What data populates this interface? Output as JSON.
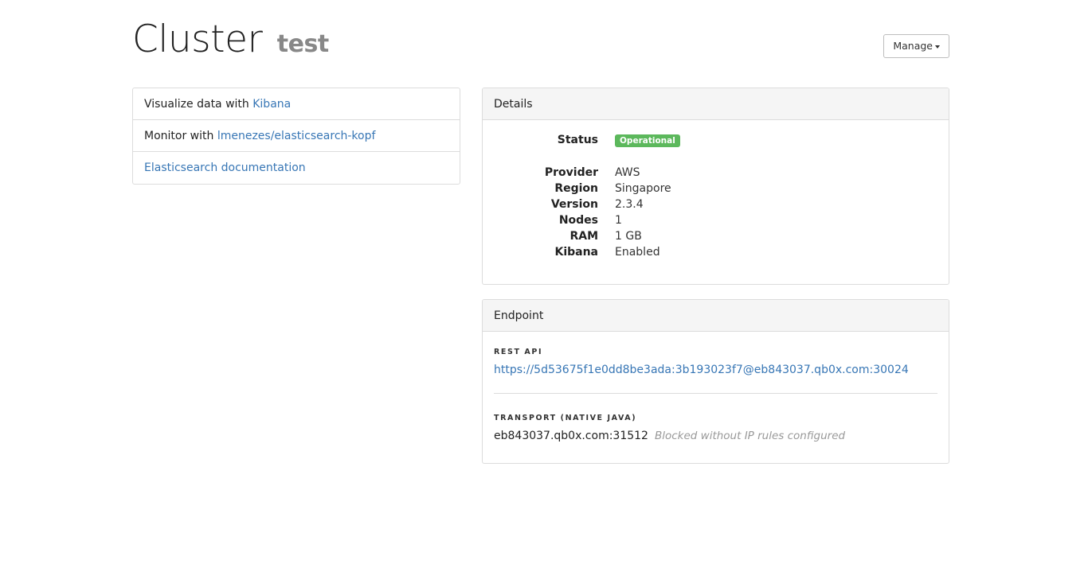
{
  "header": {
    "title": "Cluster",
    "cluster_name": "test",
    "manage_label": "Manage"
  },
  "links": [
    {
      "prefix": "Visualize data with ",
      "link": "Kibana"
    },
    {
      "prefix": "Monitor with ",
      "link": "lmenezes/elasticsearch-kopf"
    },
    {
      "prefix": "",
      "link": "Elasticsearch documentation"
    }
  ],
  "details": {
    "heading": "Details",
    "status_label": "Status",
    "status_value": "Operational",
    "rows": [
      {
        "label": "Provider",
        "value": "AWS"
      },
      {
        "label": "Region",
        "value": "Singapore"
      },
      {
        "label": "Version",
        "value": "2.3.4"
      },
      {
        "label": "Nodes",
        "value": "1"
      },
      {
        "label": "RAM",
        "value": "1 GB"
      },
      {
        "label": "Kibana",
        "value": "Enabled"
      }
    ]
  },
  "endpoint": {
    "heading": "Endpoint",
    "rest_label": "REST API",
    "rest_url": "https://5d53675f1e0dd8be3ada:3b193023f7@eb843037.qb0x.com:30024",
    "transport_label": "TRANSPORT (NATIVE JAVA)",
    "transport_value": "eb843037.qb0x.com:31512",
    "transport_note": "Blocked without IP rules configured"
  },
  "colors": {
    "link": "#3776b5",
    "status_success": "#5cb85c"
  },
  "icons": {
    "manage_caret": "caret-down-icon"
  }
}
